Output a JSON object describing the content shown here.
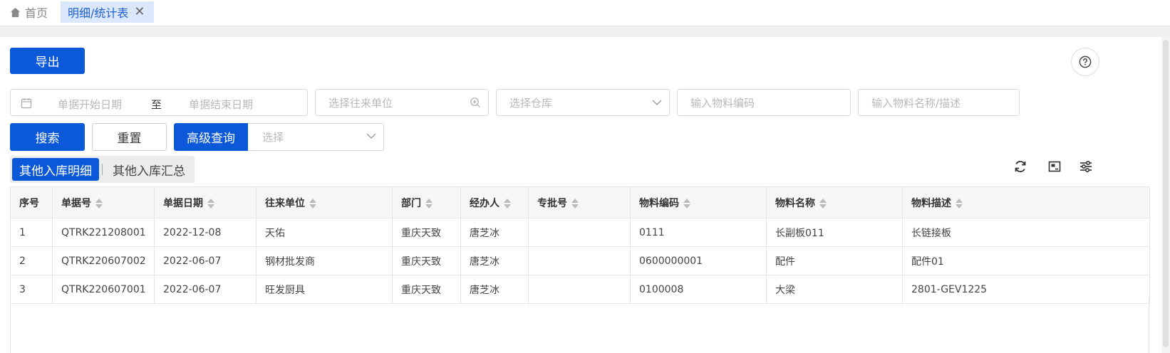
{
  "tabs": {
    "home_label": "首页",
    "active_label": "明细/统计表",
    "close_glyph": "✕"
  },
  "toolbar": {
    "export_label": "导出",
    "help_icon": "question-circle-icon"
  },
  "filters": {
    "start_date_placeholder": "单据开始日期",
    "date_separator": "至",
    "end_date_placeholder": "单据结束日期",
    "partner_placeholder": "选择往来单位",
    "warehouse_placeholder": "选择仓库",
    "material_code_placeholder": "输入物料编码",
    "material_name_placeholder": "输入物料名称/描述"
  },
  "actions": {
    "search_label": "搜索",
    "reset_label": "重置",
    "advanced_label": "高级查询",
    "advanced_select_placeholder": "选择"
  },
  "views": {
    "detail_label": "其他入库明细",
    "summary_label": "其他入库汇总"
  },
  "table": {
    "columns": [
      "序号",
      "单据号",
      "单据日期",
      "往来单位",
      "部门",
      "经办人",
      "专批号",
      "物料编码",
      "物料名称",
      "物料描述"
    ],
    "rows": [
      [
        "1",
        "QTRK221208001",
        "2022-12-08",
        "天佑",
        "重庆天致",
        "唐芝冰",
        "",
        "0111",
        "长副板011",
        "长链接板"
      ],
      [
        "2",
        "QTRK220607002",
        "2022-06-07",
        "钢材批发商",
        "重庆天致",
        "唐芝冰",
        "",
        "0600000001",
        "配件",
        "配件01"
      ],
      [
        "3",
        "QTRK220607001",
        "2022-06-07",
        "旺发厨具",
        "重庆天致",
        "唐芝冰",
        "",
        "0100008",
        "大梁",
        "2801-GEV1225"
      ]
    ]
  },
  "colors": {
    "primary": "#0b58d8",
    "active_tab_bg": "#dbe7fb"
  }
}
